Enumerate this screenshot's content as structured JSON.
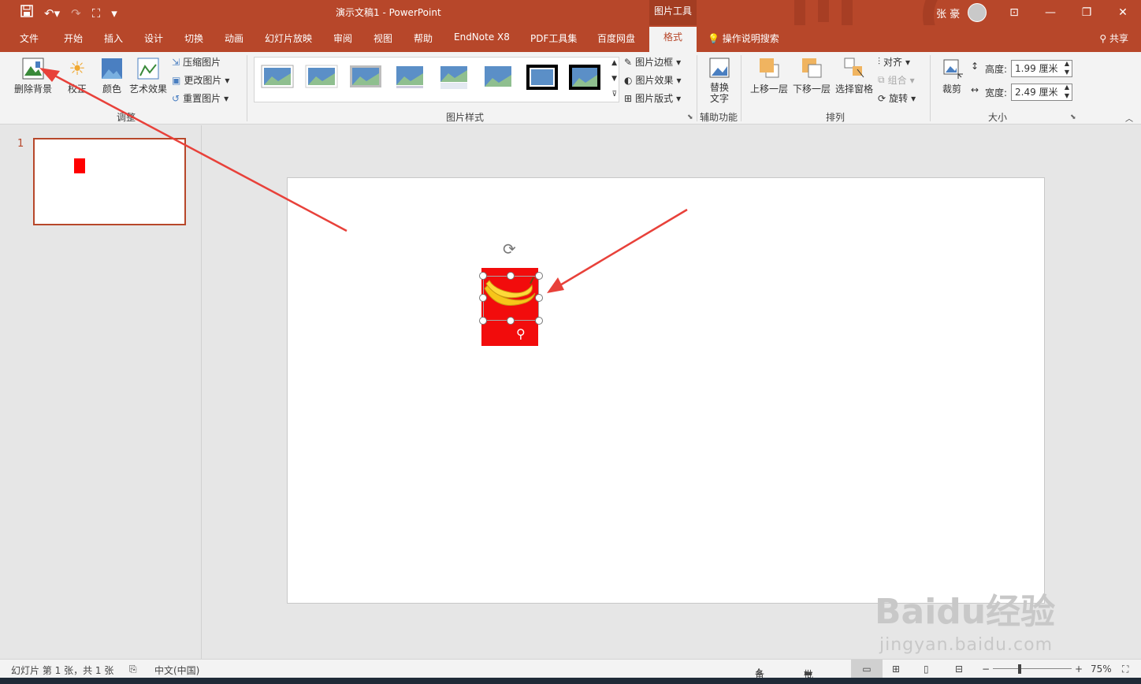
{
  "titlebar": {
    "doc_title": "演示文稿1  -  PowerPoint",
    "context_tools": "图片工具",
    "user": "张 豪",
    "qat_icons": [
      "save-icon",
      "undo-icon",
      "redo-icon",
      "present-icon",
      "customize-icon"
    ],
    "window_buttons": [
      "ribbon-display-icon",
      "minimize-icon",
      "restore-icon",
      "close-icon"
    ]
  },
  "tabs": [
    {
      "label": "文件"
    },
    {
      "label": "开始"
    },
    {
      "label": "插入"
    },
    {
      "label": "设计"
    },
    {
      "label": "切换"
    },
    {
      "label": "动画"
    },
    {
      "label": "幻灯片放映"
    },
    {
      "label": "审阅"
    },
    {
      "label": "视图"
    },
    {
      "label": "帮助"
    },
    {
      "label": "EndNote X8"
    },
    {
      "label": "PDF工具集"
    },
    {
      "label": "百度网盘"
    }
  ],
  "active_tab": "格式",
  "tell_me": "操作说明搜索",
  "share": "共享",
  "ribbon": {
    "adjust": {
      "remove_bg": "删除背景",
      "corrections": "校正",
      "color": "颜色",
      "artistic": "艺术效果",
      "compress": "压缩图片",
      "change": "更改图片",
      "reset": "重置图片",
      "label": "调整"
    },
    "styles": {
      "border": "图片边框",
      "effects": "图片效果",
      "layout": "图片版式",
      "label": "图片样式"
    },
    "accessibility": {
      "alt_text": "替换文字",
      "label": "辅助功能"
    },
    "arrange": {
      "forward": "上移一层",
      "backward": "下移一层",
      "selection": "选择窗格",
      "align": "对齐",
      "group": "组合",
      "rotate": "旋转",
      "label": "排列"
    },
    "size": {
      "crop": "裁剪",
      "height_label": "高度:",
      "height": "1.99 厘米",
      "width_label": "宽度:",
      "width": "2.49 厘米",
      "label": "大小"
    }
  },
  "slides": [
    {
      "number": "1"
    }
  ],
  "status": {
    "slide_info": "幻灯片 第 1 张，共 1 张",
    "language": "中文(中国)",
    "notes": "备注",
    "comments": "批注",
    "zoom": "75%"
  },
  "watermark": {
    "brand": "Baidu经验",
    "url": "jingyan.baidu.com"
  }
}
